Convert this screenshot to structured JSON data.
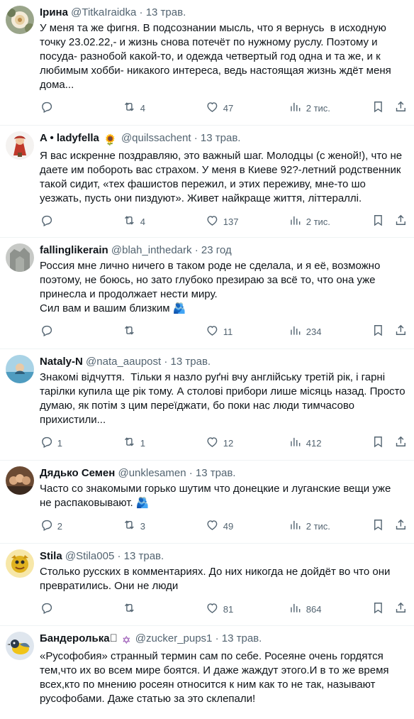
{
  "colors": {
    "text": "#0f1419",
    "secondary": "#536471",
    "divider": "#eff3f4"
  },
  "tweets": [
    {
      "name": "Ірина",
      "handle": "@TitkaIraidka",
      "dot": "·",
      "time": "13 трав.",
      "text": "У меня та же фигня. В подсознании мысль, что я вернусь  в исходную точку 23.02.22,- и жизнь снова потечёт по нужному руслу. Поэтому и посуда- разнобой какой-то, и одежда четвертый год одна и та же, и к любимым хобби- никакого интереса, ведь настоящая жизнь ждёт меня дома...",
      "replies": "",
      "retweets": "4",
      "likes": "47",
      "views": "2 тис."
    },
    {
      "name": "A • ladyfella",
      "badge": "🌻",
      "handle": "@quilssachent",
      "dot": "·",
      "time": "13 трав.",
      "text": "Я вас искренне поздравляю, это важный шаг. Молодцы (с женой!), что не даете им побороть вас страхом. У меня в Киеве 92?-летний родственник такой сидит, «тех фашистов пережил, и этих переживу, мне-то шо уезжать, пусть они пиздуют». Живет найкраще життя, літтераллі.",
      "replies": "",
      "retweets": "4",
      "likes": "137",
      "views": "2 тис."
    },
    {
      "name": "fallinglikerain",
      "handle": "@blah_inthedark",
      "dot": "·",
      "time": "23 год",
      "text": "Россия мне лично ничего в таком роде не сделала, и я её, возможно поэтому, не боюсь, но зато глубоко презираю за всё то, что она уже принесла и продолжает нести миру.\nСил вам и вашим близким 🫂",
      "replies": "",
      "retweets": "",
      "likes": "11",
      "views": "234"
    },
    {
      "name": "Nataly-N",
      "handle": "@nata_aaupost",
      "dot": "·",
      "time": "13 трав.",
      "text": "Знакомі відчуття.  Тільки я назло руґні вчу англійську третій рік, і гарні тарілки купила ще рік тому. А столові прибори лише місяць назад. Просто думаю, як потім з цим переїджати, бо поки нас люди тимчасово прихистили...",
      "replies": "1",
      "retweets": "1",
      "likes": "12",
      "views": "412"
    },
    {
      "name": "Дядько Семен",
      "handle": "@unklesamen",
      "dot": "·",
      "time": "13 трав.",
      "text": "Часто со знакомыми горько шутим что донецкие и луганские вещи уже не распаковывают. 🫂",
      "replies": "2",
      "retweets": "3",
      "likes": "49",
      "views": "2 тис."
    },
    {
      "name": "Stila",
      "handle": "@Stila005",
      "dot": "·",
      "time": "13 трав.",
      "text": "Столько русских в комментариях. До них никогда не дойдёт во что они превратились. Они не люди",
      "replies": "",
      "retweets": "",
      "likes": "81",
      "views": "864"
    },
    {
      "name": "Бандеролька⃣",
      "badge": "✡",
      "handle": "@zucker_pups1",
      "dot": "·",
      "time": "13 трав.",
      "text": "«Русофобия» странный термин сам по себе. Росеяне очень гордятся тем,что их во всем мире боятся. И даже жаждут этого.И в то же время всех,кто по мнению росеян относится к ним как то не так, называют русофобами. Даже статью за это склепали!",
      "replies": "",
      "retweets": "",
      "likes": "",
      "views": ""
    }
  ]
}
